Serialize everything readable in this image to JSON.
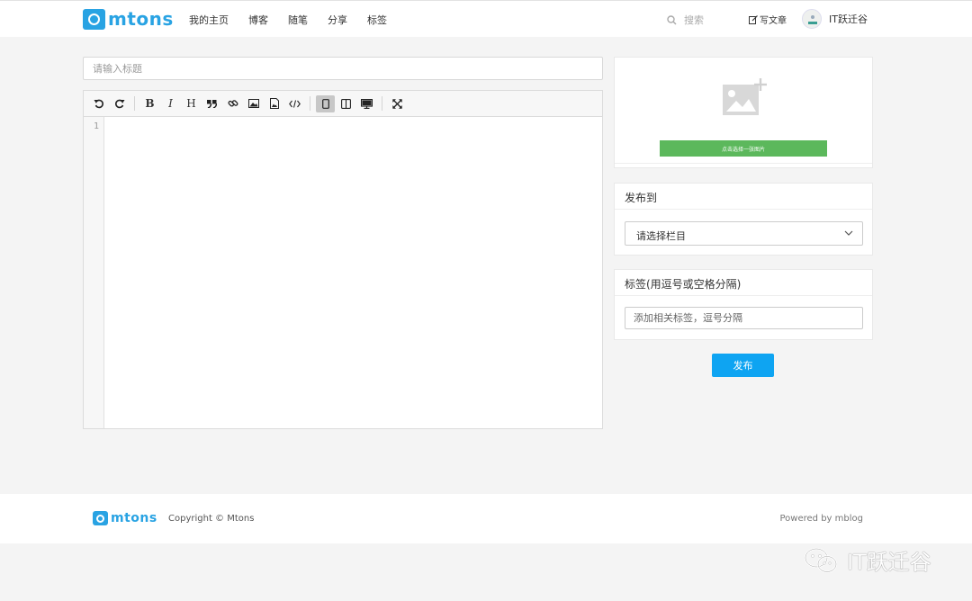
{
  "header": {
    "logo_text": "mtons",
    "nav": [
      "我的主页",
      "博客",
      "随笔",
      "分享",
      "标签"
    ],
    "search_placeholder": "搜索",
    "write_label": "写文章",
    "username": "IT跃迁谷"
  },
  "editor": {
    "title_placeholder": "请输入标题",
    "toolbar_icons": [
      "undo-icon",
      "redo-icon",
      "bold-icon",
      "italic-icon",
      "heading-icon",
      "quote-icon",
      "link-icon",
      "image-icon",
      "upload-image-icon",
      "code-icon",
      "edit-mode-icon",
      "split-mode-icon",
      "preview-mode-icon",
      "fullscreen-icon"
    ],
    "bold_glyph": "B",
    "italic_glyph": "I",
    "heading_glyph": "H",
    "line_number": "1"
  },
  "sidebar": {
    "cover_button": "点击选择一张图片",
    "publish_to_title": "发布到",
    "column_select": "请选择栏目",
    "tags_title": "标签(用逗号或空格分隔)",
    "tags_placeholder": "添加相关标签，逗号分隔",
    "publish_button": "发布"
  },
  "footer": {
    "logo_text": "mtons",
    "copyright": "Copyright © Mtons",
    "powered_prefix": "Powered by",
    "powered_name": "mblog"
  },
  "watermark": "IT跃迁谷",
  "colors": {
    "brand": "#29a3e3",
    "primary_button": "#0ea4f2",
    "cover_button": "#5cb85c",
    "page_bg": "#f4f4f4"
  }
}
